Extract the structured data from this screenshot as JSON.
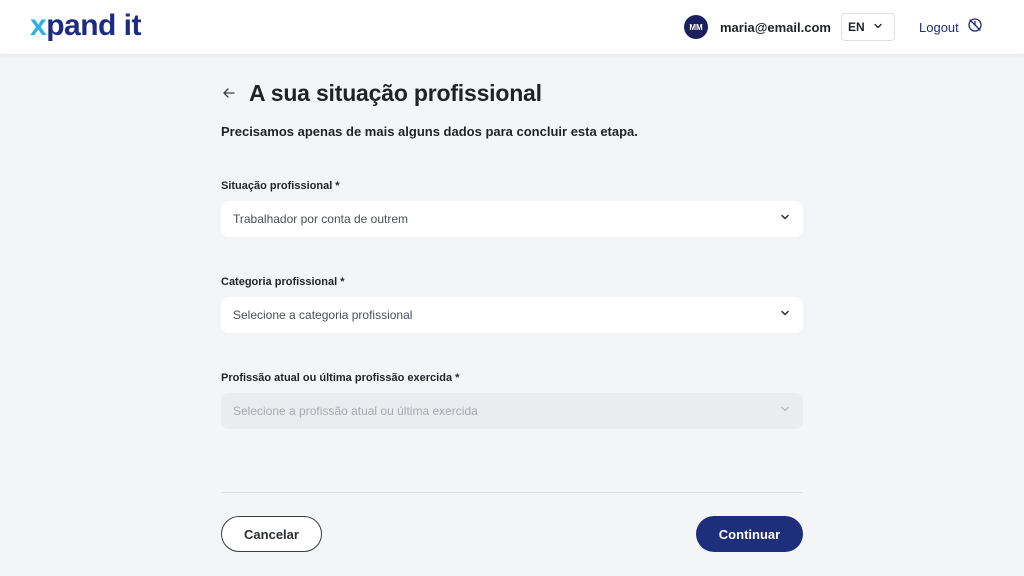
{
  "header": {
    "logo_prefix": "x",
    "logo_rest": "pand it",
    "avatar_initials": "MM",
    "email": "maria@email.com",
    "language": "EN",
    "logout_label": "Logout"
  },
  "page": {
    "title": "A sua situação profissional",
    "subtitle": "Precisamos apenas de mais alguns dados para concluir esta etapa."
  },
  "fields": [
    {
      "label": "Situação profissional *",
      "value": "Trabalhador por conta de outrem",
      "disabled": false
    },
    {
      "label": "Categoria profissional *",
      "value": "Selecione a categoria profissional",
      "disabled": false
    },
    {
      "label": "Profissão atual ou última profissão exercida *",
      "value": "Selecione a profissão atual ou última exercida",
      "disabled": true
    }
  ],
  "actions": {
    "cancel_label": "Cancelar",
    "continue_label": "Continuar"
  },
  "colors": {
    "brand_navy": "#1d2b80",
    "brand_cyan": "#2ab3e6",
    "primary_button": "#1d2e7a",
    "background": "#f4f5f7"
  },
  "icons": {
    "back": "arrow-left-icon",
    "chevron": "chevron-down-icon",
    "logout": "logout-icon"
  }
}
